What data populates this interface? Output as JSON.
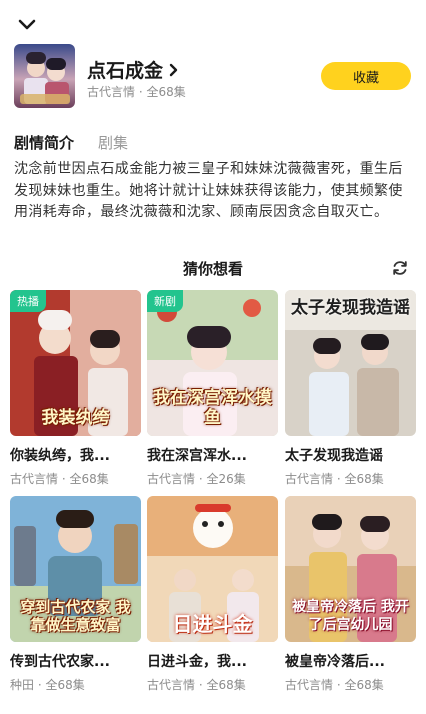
{
  "header": {
    "collapse_icon": "chevron-down-icon"
  },
  "drama": {
    "title": "点石成金",
    "meta": "古代言情 · 全68集",
    "collect_label": "收藏"
  },
  "tabs": [
    {
      "label": "剧情简介",
      "active": true
    },
    {
      "label": "剧集",
      "active": false
    }
  ],
  "synopsis": "沈念前世因点石成金能力被三皇子和妹妹沈薇薇害死，重生后发现妹妹也重生。她将计就计让妹妹获得该能力，使其频繁使用消耗寿命，最终沈薇薇和沈家、顾南辰因贪念自取灭亡。",
  "recommend": {
    "title": "猜你想看",
    "refresh_icon": "refresh-icon",
    "items": [
      {
        "title": "你装纨绔，我...",
        "meta": "古代言情 · 全68集",
        "badge": "热播",
        "caption": "我装纨绔",
        "colors": [
          "#b23a2e",
          "#f2d6c4"
        ]
      },
      {
        "title": "我在深宫浑水...",
        "meta": "古代言情 · 全26集",
        "badge": "新剧",
        "caption": "我在深宫浑水摸鱼",
        "colors": [
          "#c7d9b5",
          "#f6e6ea"
        ]
      },
      {
        "title": "太子发现我造谣",
        "meta": "古代言情 · 全68集",
        "badge": "",
        "caption": "太子发现我造谣",
        "colors": [
          "#d8d2c8",
          "#eeeae3"
        ]
      },
      {
        "title": "传到古代农家...",
        "meta": "种田 · 全68集",
        "badge": "",
        "caption": "穿到古代农家 我靠做生意致富",
        "colors": [
          "#7fb3d8",
          "#c9d7a8"
        ]
      },
      {
        "title": "日进斗金，我...",
        "meta": "古代言情 · 全68集",
        "badge": "",
        "caption": "日进斗金",
        "colors": [
          "#e8b07a",
          "#f3e2c8"
        ]
      },
      {
        "title": "被皇帝冷落后...",
        "meta": "古代言情 · 全68集",
        "badge": "",
        "caption": "被皇帝冷落后 我开了后宫幼儿园",
        "colors": [
          "#d9b88c",
          "#f0dccb"
        ]
      }
    ]
  },
  "colors": {
    "accent": "#ffd21e",
    "badge": "#23c48e",
    "meta_text": "#8c8c8c"
  }
}
